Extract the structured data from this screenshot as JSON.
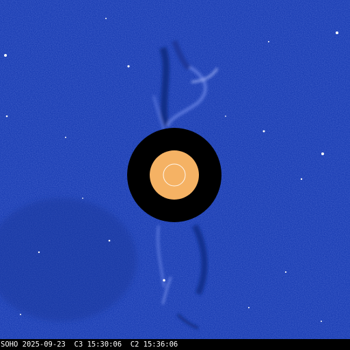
{
  "image": {
    "background_color": "#1c3fb4",
    "occulter_color": "#000000",
    "sun_disc_color": "#f5b264",
    "sun_outline_color": "#ffffff",
    "star_color": "#ffffff"
  },
  "caption": {
    "observatory": "SOHO",
    "date": "2025-09-23",
    "c3_time": "C3 15:30:06",
    "c2_time": "C2 15:36:06",
    "color": "#ffffff"
  }
}
